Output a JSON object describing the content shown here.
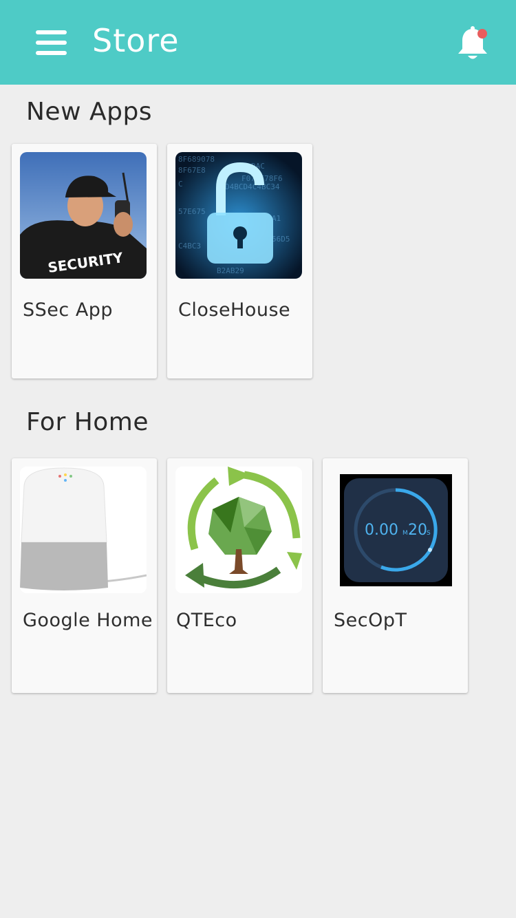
{
  "header": {
    "title": "Store",
    "menu_icon": "hamburger-menu-icon",
    "notification_icon": "bell-icon",
    "colors": {
      "bar": "#4ecbc6",
      "badge": "#e85d5d"
    }
  },
  "sections": [
    {
      "title": "New Apps",
      "apps": [
        {
          "name": "SSec App",
          "thumb_text": "SECURITY"
        },
        {
          "name": "CloseHouse"
        }
      ]
    },
    {
      "title": "For Home",
      "apps": [
        {
          "name": "Google Home"
        },
        {
          "name": "QTEco"
        },
        {
          "name": "SecOpT",
          "thumb_text": {
            "time": "0.00",
            "minutes": "20",
            "m_unit": "M",
            "s_unit": "S"
          }
        }
      ]
    }
  ]
}
